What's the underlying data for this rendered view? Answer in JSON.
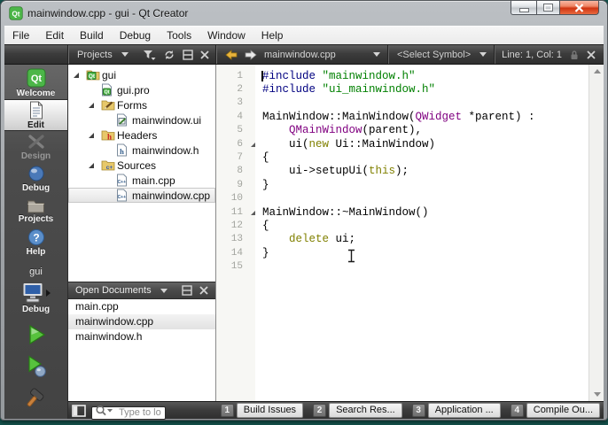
{
  "window": {
    "title": "mainwindow.cpp - gui - Qt Creator"
  },
  "window_controls": {
    "minimize": "minimize",
    "maximize": "maximize",
    "close": "close"
  },
  "menu": {
    "items": [
      "File",
      "Edit",
      "Build",
      "Debug",
      "Tools",
      "Window",
      "Help"
    ]
  },
  "nav": {
    "pane_label": "Projects",
    "file_tab": "mainwindow.cpp",
    "symbol_selector": "<Select Symbol>",
    "line_col": "Line: 1, Col: 1"
  },
  "sidebar": {
    "modes": [
      {
        "label": "Welcome",
        "icon": "qt-logo",
        "state": "normal"
      },
      {
        "label": "Edit",
        "icon": "edit-doc",
        "state": "selected"
      },
      {
        "label": "Design",
        "icon": "design-tools",
        "state": "disabled"
      },
      {
        "label": "Debug",
        "icon": "debug-orb",
        "state": "normal"
      },
      {
        "label": "Projects",
        "icon": "projects-folder",
        "state": "normal"
      },
      {
        "label": "Help",
        "icon": "help-circle",
        "state": "normal"
      }
    ],
    "project_label": "gui",
    "target": {
      "config_label": "Debug",
      "icon": "target-computer"
    },
    "actions": [
      {
        "name": "run",
        "icon": "run-play"
      },
      {
        "name": "start-debugging",
        "icon": "debug-play"
      },
      {
        "name": "build",
        "icon": "build-hammer"
      }
    ]
  },
  "project_tree": {
    "items": [
      {
        "label": "gui",
        "depth": 0,
        "icon": "folder-qt",
        "expanded": true,
        "selected": false
      },
      {
        "label": "gui.pro",
        "depth": 1,
        "icon": "file-pro",
        "expanded": null,
        "selected": false
      },
      {
        "label": "Forms",
        "depth": 1,
        "icon": "folder-forms",
        "expanded": true,
        "selected": false
      },
      {
        "label": "mainwindow.ui",
        "depth": 2,
        "icon": "file-ui",
        "expanded": null,
        "selected": false
      },
      {
        "label": "Headers",
        "depth": 1,
        "icon": "folder-headers",
        "expanded": true,
        "selected": false
      },
      {
        "label": "mainwindow.h",
        "depth": 2,
        "icon": "file-h",
        "expanded": null,
        "selected": false
      },
      {
        "label": "Sources",
        "depth": 1,
        "icon": "folder-sources",
        "expanded": true,
        "selected": false
      },
      {
        "label": "main.cpp",
        "depth": 2,
        "icon": "file-cpp",
        "expanded": null,
        "selected": false
      },
      {
        "label": "mainwindow.cpp",
        "depth": 2,
        "icon": "file-cpp",
        "expanded": null,
        "selected": true
      }
    ]
  },
  "open_documents": {
    "title": "Open Documents",
    "items": [
      "main.cpp",
      "mainwindow.cpp",
      "mainwindow.h"
    ],
    "selected_index": 1
  },
  "editor": {
    "cursor": {
      "line": 1,
      "col": 1
    },
    "lines": [
      {
        "num": 1,
        "fold": false,
        "seg": [
          [
            "p",
            "#include "
          ],
          [
            "s",
            "\"mainwindow.h\""
          ]
        ]
      },
      {
        "num": 2,
        "fold": false,
        "seg": [
          [
            "p",
            "#include "
          ],
          [
            "s",
            "\"ui_mainwindow.h\""
          ]
        ]
      },
      {
        "num": 3,
        "fold": false,
        "seg": []
      },
      {
        "num": 4,
        "fold": false,
        "seg": [
          [
            "n",
            "MainWindow::MainWindow("
          ],
          [
            "t",
            "QWidget"
          ],
          [
            "n",
            " *parent) :"
          ]
        ]
      },
      {
        "num": 5,
        "fold": false,
        "seg": [
          [
            "n",
            "    "
          ],
          [
            "t",
            "QMainWindow"
          ],
          [
            "n",
            "(parent),"
          ]
        ]
      },
      {
        "num": 6,
        "fold": true,
        "seg": [
          [
            "n",
            "    ui("
          ],
          [
            "k",
            "new"
          ],
          [
            "n",
            " Ui::MainWindow)"
          ]
        ]
      },
      {
        "num": 7,
        "fold": false,
        "seg": [
          [
            "n",
            "{"
          ]
        ]
      },
      {
        "num": 8,
        "fold": false,
        "seg": [
          [
            "n",
            "    ui->setupUi("
          ],
          [
            "k",
            "this"
          ],
          [
            "n",
            ");"
          ]
        ]
      },
      {
        "num": 9,
        "fold": false,
        "seg": [
          [
            "n",
            "}"
          ]
        ]
      },
      {
        "num": 10,
        "fold": false,
        "seg": []
      },
      {
        "num": 11,
        "fold": true,
        "seg": [
          [
            "n",
            "MainWindow::~MainWindow()"
          ]
        ]
      },
      {
        "num": 12,
        "fold": false,
        "seg": [
          [
            "n",
            "{"
          ]
        ]
      },
      {
        "num": 13,
        "fold": false,
        "seg": [
          [
            "n",
            "    "
          ],
          [
            "k",
            "delete"
          ],
          [
            "n",
            " ui;"
          ]
        ]
      },
      {
        "num": 14,
        "fold": false,
        "seg": [
          [
            "n",
            "}"
          ]
        ]
      },
      {
        "num": 15,
        "fold": false,
        "seg": []
      }
    ]
  },
  "locator": {
    "placeholder": "Type to locate"
  },
  "output_panes": [
    {
      "key": "1",
      "label": "Build Issues"
    },
    {
      "key": "2",
      "label": "Search Res..."
    },
    {
      "key": "3",
      "label": "Application ..."
    },
    {
      "key": "4",
      "label": "Compile Ou..."
    }
  ],
  "colors": {
    "desktop": "#14524c",
    "syntax_preprocessor": "#000080",
    "syntax_string": "#008000",
    "syntax_type": "#800080",
    "syntax_keyword": "#808000",
    "run_green": "#57c23d",
    "back_arrow_gold": "#e8b33c",
    "close_button_red": "#cf3512"
  }
}
